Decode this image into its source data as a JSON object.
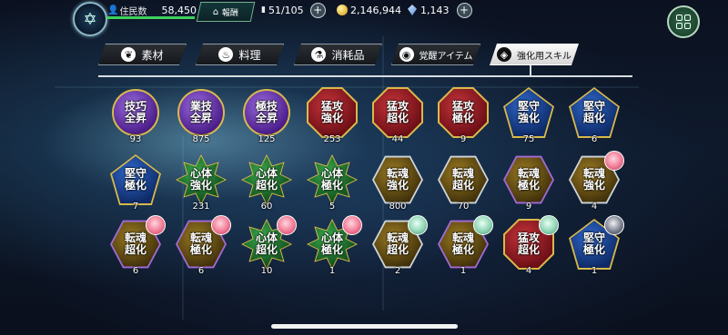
{
  "header": {
    "emblem_icon": "hexagram-emblem-icon",
    "residents_label": "住民数",
    "residents_value": "58,450",
    "residents_progress": 1.0,
    "hq_label": "報酬",
    "hq_icon": "house-icon",
    "stamina_value": "51/105",
    "stamina_icon": "energy-icon",
    "coins_value": "2,146,944",
    "coin_icon": "coin-icon",
    "gems_value": "1,143",
    "gem_icon": "crystal-icon",
    "menu_icon": "grid-menu-icon"
  },
  "tabs": [
    {
      "label": "素材",
      "icon": "leaf-icon",
      "active": false
    },
    {
      "label": "料理",
      "icon": "pot-icon",
      "active": false
    },
    {
      "label": "消耗品",
      "icon": "flask-icon",
      "active": false
    },
    {
      "label": "覚醒アイテム",
      "icon": "pouch-icon",
      "active": false
    },
    {
      "label": "強化用スキル",
      "icon": "skill-diamond-icon",
      "active": true
    }
  ],
  "items": [
    {
      "label": "技巧\n全昇",
      "count": "93",
      "shape": "circle",
      "color": "#6a3fb5"
    },
    {
      "label": "業技\n全昇",
      "count": "875",
      "shape": "circle",
      "color": "#6a3fb5"
    },
    {
      "label": "極技\n全昇",
      "count": "125",
      "shape": "circle",
      "color": "#6a3fb5"
    },
    {
      "label": "猛攻\n強化",
      "count": "253",
      "shape": "oct",
      "color": "#a0222a"
    },
    {
      "label": "猛攻\n超化",
      "count": "44",
      "shape": "oct",
      "color": "#a0222a"
    },
    {
      "label": "猛攻\n極化",
      "count": "9",
      "shape": "oct",
      "color": "#a0222a"
    },
    {
      "label": "堅守\n強化",
      "count": "75",
      "shape": "pent",
      "color": "#1f4fa8"
    },
    {
      "label": "堅守\n超化",
      "count": "6",
      "shape": "pent",
      "color": "#1f4fa8"
    },
    {
      "label": "堅守\n極化",
      "count": "7",
      "shape": "pent",
      "color": "#1f4fa8"
    },
    {
      "label": "心体\n強化",
      "count": "231",
      "shape": "star",
      "color": "#2a8a3a"
    },
    {
      "label": "心体\n超化",
      "count": "60",
      "shape": "star",
      "color": "#2a8a3a"
    },
    {
      "label": "心体\n極化",
      "count": "5",
      "shape": "star",
      "color": "#2a8a3a"
    },
    {
      "label": "転魂\n強化",
      "count": "800",
      "shape": "hex",
      "color": "#7a5d14"
    },
    {
      "label": "転魂\n超化",
      "count": "70",
      "shape": "hex",
      "color": "#7a5d14"
    },
    {
      "label": "転魂\n極化",
      "count": "9",
      "shape": "hex",
      "color": "#7a5d14"
    },
    {
      "label": "転魂\n強化",
      "count": "4",
      "shape": "hex",
      "color": "#7a5d14",
      "avatar": "pink-haired-character-avatar"
    },
    {
      "label": "転魂\n超化",
      "count": "6",
      "shape": "hex",
      "color": "#7a5d14",
      "avatar": "pink-haired-character-avatar"
    },
    {
      "label": "転魂\n極化",
      "count": "6",
      "shape": "hex",
      "color": "#7a5d14",
      "avatar": "pink-haired-character-avatar"
    },
    {
      "label": "心体\n超化",
      "count": "10",
      "shape": "star",
      "color": "#2a8a3a",
      "avatar": "pink-haired-character-avatar"
    },
    {
      "label": "心体\n極化",
      "count": "1",
      "shape": "star",
      "color": "#2a8a3a",
      "avatar": "pink-haired-character-avatar"
    },
    {
      "label": "転魂\n超化",
      "count": "2",
      "shape": "hex",
      "color": "#7a5d14",
      "avatar": "green-haired-character-avatar"
    },
    {
      "label": "転魂\n極化",
      "count": "1",
      "shape": "hex",
      "color": "#7a5d14",
      "avatar": "green-haired-character-avatar"
    },
    {
      "label": "猛攻\n超化",
      "count": "4",
      "shape": "oct",
      "color": "#a0222a",
      "avatar": "green-haired-character-avatar"
    },
    {
      "label": "堅守\n極化",
      "count": "1",
      "shape": "pent",
      "color": "#1f4fa8",
      "avatar": "dark-haired-character-avatar"
    }
  ]
}
